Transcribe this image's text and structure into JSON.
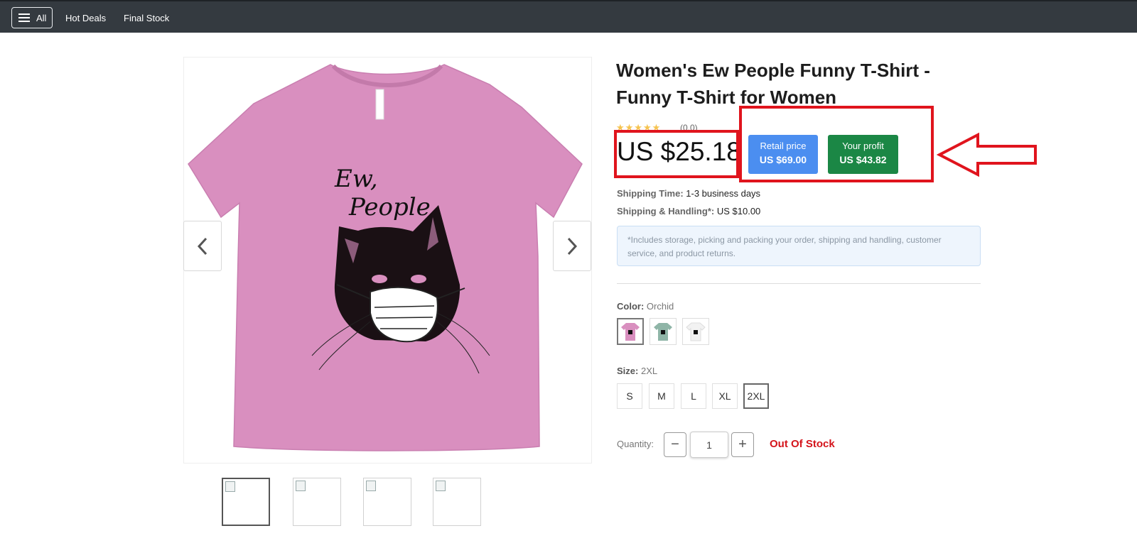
{
  "nav": {
    "all_label": "All",
    "links": [
      "Hot Deals",
      "Final Stock"
    ]
  },
  "product": {
    "title_line1": "Women's Ew People Funny T-Shirt -",
    "title_line2": "Funny T-Shirt for Women",
    "stars": "★★★★★",
    "rating": "(0.0)",
    "price": "US $25.18",
    "retail_label": "Retail price",
    "retail_value": "US $69.00",
    "profit_label": "Your profit",
    "profit_value": "US $43.82",
    "shipping_time_label": "Shipping Time:",
    "shipping_time_value": "1-3 business days",
    "shipping_handling_label": "Shipping & Handling*:",
    "shipping_handling_value": "US $10.00",
    "note": "*Includes storage, picking and packing your order, shipping and handling, customer service, and product returns.",
    "color_label": "Color:",
    "color_value": "Orchid",
    "size_label": "Size:",
    "size_value": "2XL",
    "sizes": [
      "S",
      "M",
      "L",
      "XL",
      "2XL"
    ],
    "quantity_label": "Quantity:",
    "quantity_value": "1",
    "stock_status": "Out Of Stock"
  },
  "shirt_print": {
    "line1": "Ew,",
    "line2": "People"
  },
  "colors": {
    "shirt_orchid": "#d98fbf",
    "shirt_teal": "#8fb5a7",
    "shirt_white": "#f2f2f2",
    "nav_bg": "#343a40",
    "retail_badge": "#4b8ef0",
    "profit_badge": "#1b8745",
    "annotation_red": "#e0141d",
    "stock_red": "#d4141b"
  }
}
